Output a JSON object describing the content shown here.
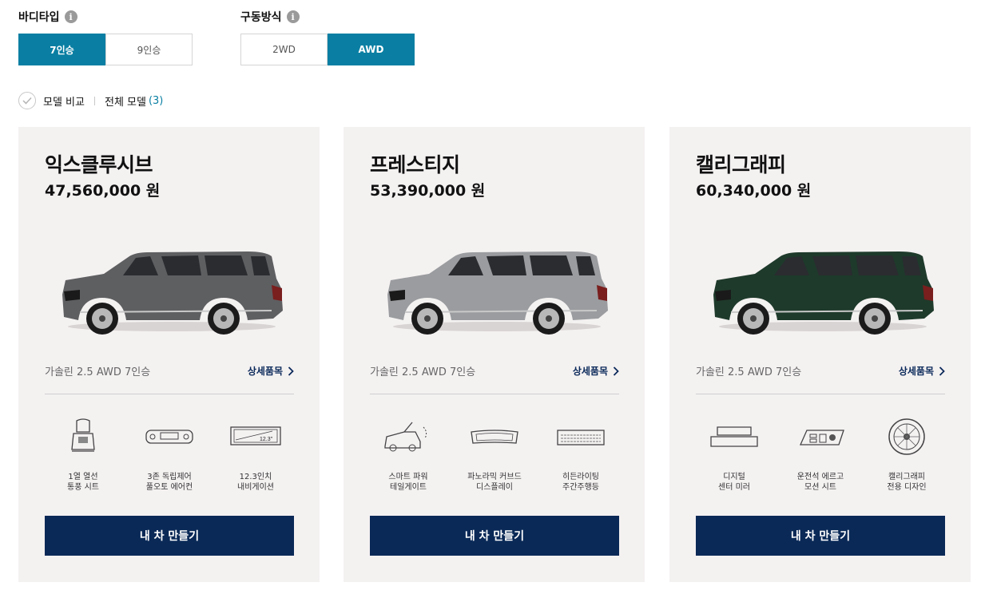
{
  "filters": {
    "body_type": {
      "label": "바디타입",
      "options": [
        "7인승",
        "9인승"
      ],
      "selected": "7인승"
    },
    "drive": {
      "label": "구동방식",
      "options": [
        "2WD",
        "AWD"
      ],
      "selected": "AWD"
    }
  },
  "compare": {
    "label": "모델 비교",
    "all_models": "전체 모델",
    "count": "(3)"
  },
  "cards": [
    {
      "name": "익스클루시브",
      "price": "47,560,000 원",
      "car_color": "#5e5f61",
      "trim": "가솔린 2.5 AWD 7인승",
      "detail_link": "상세품목",
      "features": [
        {
          "icon": "heated-seat-icon",
          "text": "1열 열선\n통풍 시트"
        },
        {
          "icon": "climate-control-icon",
          "text": "3존 독립제어\n풀오토 에어컨"
        },
        {
          "icon": "navigation-display-icon",
          "text": "12.3인치\n내비게이션"
        }
      ],
      "cta": "내 차 만들기"
    },
    {
      "name": "프레스티지",
      "price": "53,390,000 원",
      "car_color": "#9a9c9f",
      "trim": "가솔린 2.5 AWD 7인승",
      "detail_link": "상세품목",
      "features": [
        {
          "icon": "power-tailgate-icon",
          "text": "스마트 파워\n테일게이트"
        },
        {
          "icon": "curved-display-icon",
          "text": "파노라믹 커브드\n디스플레이"
        },
        {
          "icon": "hidden-lighting-icon",
          "text": "히든라이팅\n주간주행등"
        }
      ],
      "cta": "내 차 만들기"
    },
    {
      "name": "캘리그래피",
      "price": "60,340,000 원",
      "car_color": "#1e3a2b",
      "trim": "가솔린 2.5 AWD 7인승",
      "detail_link": "상세품목",
      "features": [
        {
          "icon": "digital-mirror-icon",
          "text": "디지털\n센터 미러"
        },
        {
          "icon": "ergo-seat-icon",
          "text": "운전석 에르고\n모션 시트"
        },
        {
          "icon": "calligraphy-wheel-icon",
          "text": "캘리그래피\n전용 디자인"
        }
      ],
      "cta": "내 차 만들기"
    }
  ]
}
